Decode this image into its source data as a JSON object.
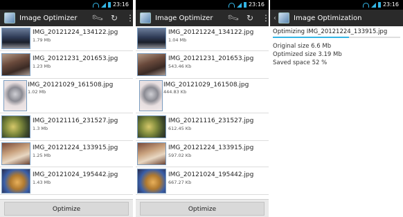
{
  "status_time": "23:16",
  "accent_color": "#33b5e5",
  "screens": {
    "list1": {
      "title": "Image Optimizer",
      "optimize_label": "Optimize",
      "items": [
        {
          "name": "IMG_20121224_134122.jpg",
          "size": "1.79 Mb",
          "thumb": "car"
        },
        {
          "name": "IMG_20121231_201653.jpg",
          "size": "1.23 Mb",
          "thumb": "room"
        },
        {
          "name": "IMG_20121029_161508.jpg",
          "size": "1.02 Mb",
          "thumb": "robot"
        },
        {
          "name": "IMG_20121116_231527.jpg",
          "size": "1.3 Mb",
          "thumb": "food"
        },
        {
          "name": "IMG_20121224_133915.jpg",
          "size": "1.25 Mb",
          "thumb": "cat"
        },
        {
          "name": "IMG_20121024_195442.jpg",
          "size": "1.43 Mb",
          "thumb": "plush"
        }
      ]
    },
    "list2": {
      "title": "Image Optimizer",
      "optimize_label": "Optimize",
      "items": [
        {
          "name": "IMG_20121224_134122.jpg",
          "size": "1.04 Mb",
          "thumb": "car"
        },
        {
          "name": "IMG_20121231_201653.jpg",
          "size": "543.46 Kb",
          "thumb": "room"
        },
        {
          "name": "IMG_20121029_161508.jpg",
          "size": "444.83 Kb",
          "thumb": "robot"
        },
        {
          "name": "IMG_20121116_231527.jpg",
          "size": "612.45 Kb",
          "thumb": "food"
        },
        {
          "name": "IMG_20121224_133915.jpg",
          "size": "597.02 Kb",
          "thumb": "cat"
        },
        {
          "name": "IMG_20121024_195442.jpg",
          "size": "667.27 Kb",
          "thumb": "plush"
        }
      ]
    },
    "optimization": {
      "title": "Image Optimization",
      "header": "Optimizing IMG_20121224_133915.jpg",
      "progress_fraction": 0.6,
      "original_size": "Original size 6.6 Mb",
      "optimized_size": "Optimized size 3.19 Mb",
      "saved_space": "Saved space 52 %"
    }
  }
}
